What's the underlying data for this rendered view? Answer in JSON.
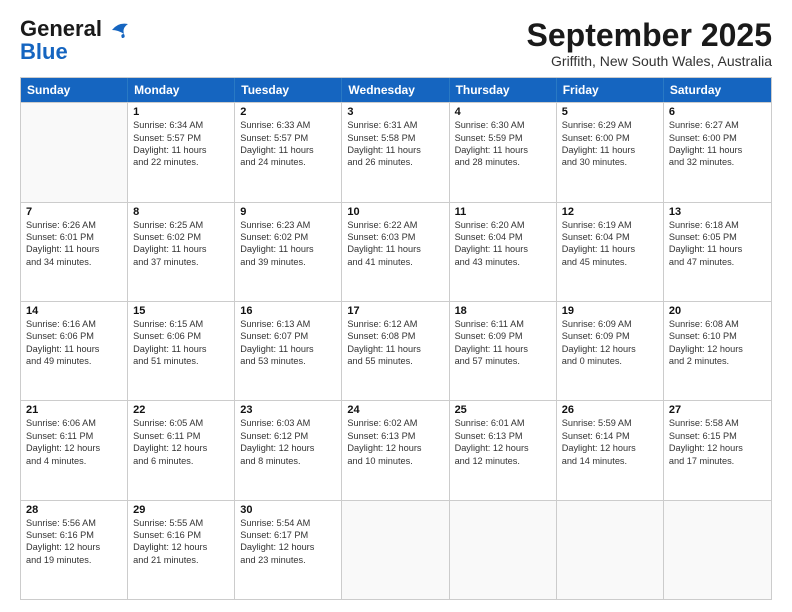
{
  "header": {
    "logo_line1": "General",
    "logo_line2": "Blue",
    "month": "September 2025",
    "location": "Griffith, New South Wales, Australia"
  },
  "weekdays": [
    "Sunday",
    "Monday",
    "Tuesday",
    "Wednesday",
    "Thursday",
    "Friday",
    "Saturday"
  ],
  "weeks": [
    [
      {
        "day": "",
        "lines": []
      },
      {
        "day": "1",
        "lines": [
          "Sunrise: 6:34 AM",
          "Sunset: 5:57 PM",
          "Daylight: 11 hours",
          "and 22 minutes."
        ]
      },
      {
        "day": "2",
        "lines": [
          "Sunrise: 6:33 AM",
          "Sunset: 5:57 PM",
          "Daylight: 11 hours",
          "and 24 minutes."
        ]
      },
      {
        "day": "3",
        "lines": [
          "Sunrise: 6:31 AM",
          "Sunset: 5:58 PM",
          "Daylight: 11 hours",
          "and 26 minutes."
        ]
      },
      {
        "day": "4",
        "lines": [
          "Sunrise: 6:30 AM",
          "Sunset: 5:59 PM",
          "Daylight: 11 hours",
          "and 28 minutes."
        ]
      },
      {
        "day": "5",
        "lines": [
          "Sunrise: 6:29 AM",
          "Sunset: 6:00 PM",
          "Daylight: 11 hours",
          "and 30 minutes."
        ]
      },
      {
        "day": "6",
        "lines": [
          "Sunrise: 6:27 AM",
          "Sunset: 6:00 PM",
          "Daylight: 11 hours",
          "and 32 minutes."
        ]
      }
    ],
    [
      {
        "day": "7",
        "lines": [
          "Sunrise: 6:26 AM",
          "Sunset: 6:01 PM",
          "Daylight: 11 hours",
          "and 34 minutes."
        ]
      },
      {
        "day": "8",
        "lines": [
          "Sunrise: 6:25 AM",
          "Sunset: 6:02 PM",
          "Daylight: 11 hours",
          "and 37 minutes."
        ]
      },
      {
        "day": "9",
        "lines": [
          "Sunrise: 6:23 AM",
          "Sunset: 6:02 PM",
          "Daylight: 11 hours",
          "and 39 minutes."
        ]
      },
      {
        "day": "10",
        "lines": [
          "Sunrise: 6:22 AM",
          "Sunset: 6:03 PM",
          "Daylight: 11 hours",
          "and 41 minutes."
        ]
      },
      {
        "day": "11",
        "lines": [
          "Sunrise: 6:20 AM",
          "Sunset: 6:04 PM",
          "Daylight: 11 hours",
          "and 43 minutes."
        ]
      },
      {
        "day": "12",
        "lines": [
          "Sunrise: 6:19 AM",
          "Sunset: 6:04 PM",
          "Daylight: 11 hours",
          "and 45 minutes."
        ]
      },
      {
        "day": "13",
        "lines": [
          "Sunrise: 6:18 AM",
          "Sunset: 6:05 PM",
          "Daylight: 11 hours",
          "and 47 minutes."
        ]
      }
    ],
    [
      {
        "day": "14",
        "lines": [
          "Sunrise: 6:16 AM",
          "Sunset: 6:06 PM",
          "Daylight: 11 hours",
          "and 49 minutes."
        ]
      },
      {
        "day": "15",
        "lines": [
          "Sunrise: 6:15 AM",
          "Sunset: 6:06 PM",
          "Daylight: 11 hours",
          "and 51 minutes."
        ]
      },
      {
        "day": "16",
        "lines": [
          "Sunrise: 6:13 AM",
          "Sunset: 6:07 PM",
          "Daylight: 11 hours",
          "and 53 minutes."
        ]
      },
      {
        "day": "17",
        "lines": [
          "Sunrise: 6:12 AM",
          "Sunset: 6:08 PM",
          "Daylight: 11 hours",
          "and 55 minutes."
        ]
      },
      {
        "day": "18",
        "lines": [
          "Sunrise: 6:11 AM",
          "Sunset: 6:09 PM",
          "Daylight: 11 hours",
          "and 57 minutes."
        ]
      },
      {
        "day": "19",
        "lines": [
          "Sunrise: 6:09 AM",
          "Sunset: 6:09 PM",
          "Daylight: 12 hours",
          "and 0 minutes."
        ]
      },
      {
        "day": "20",
        "lines": [
          "Sunrise: 6:08 AM",
          "Sunset: 6:10 PM",
          "Daylight: 12 hours",
          "and 2 minutes."
        ]
      }
    ],
    [
      {
        "day": "21",
        "lines": [
          "Sunrise: 6:06 AM",
          "Sunset: 6:11 PM",
          "Daylight: 12 hours",
          "and 4 minutes."
        ]
      },
      {
        "day": "22",
        "lines": [
          "Sunrise: 6:05 AM",
          "Sunset: 6:11 PM",
          "Daylight: 12 hours",
          "and 6 minutes."
        ]
      },
      {
        "day": "23",
        "lines": [
          "Sunrise: 6:03 AM",
          "Sunset: 6:12 PM",
          "Daylight: 12 hours",
          "and 8 minutes."
        ]
      },
      {
        "day": "24",
        "lines": [
          "Sunrise: 6:02 AM",
          "Sunset: 6:13 PM",
          "Daylight: 12 hours",
          "and 10 minutes."
        ]
      },
      {
        "day": "25",
        "lines": [
          "Sunrise: 6:01 AM",
          "Sunset: 6:13 PM",
          "Daylight: 12 hours",
          "and 12 minutes."
        ]
      },
      {
        "day": "26",
        "lines": [
          "Sunrise: 5:59 AM",
          "Sunset: 6:14 PM",
          "Daylight: 12 hours",
          "and 14 minutes."
        ]
      },
      {
        "day": "27",
        "lines": [
          "Sunrise: 5:58 AM",
          "Sunset: 6:15 PM",
          "Daylight: 12 hours",
          "and 17 minutes."
        ]
      }
    ],
    [
      {
        "day": "28",
        "lines": [
          "Sunrise: 5:56 AM",
          "Sunset: 6:16 PM",
          "Daylight: 12 hours",
          "and 19 minutes."
        ]
      },
      {
        "day": "29",
        "lines": [
          "Sunrise: 5:55 AM",
          "Sunset: 6:16 PM",
          "Daylight: 12 hours",
          "and 21 minutes."
        ]
      },
      {
        "day": "30",
        "lines": [
          "Sunrise: 5:54 AM",
          "Sunset: 6:17 PM",
          "Daylight: 12 hours",
          "and 23 minutes."
        ]
      },
      {
        "day": "",
        "lines": []
      },
      {
        "day": "",
        "lines": []
      },
      {
        "day": "",
        "lines": []
      },
      {
        "day": "",
        "lines": []
      }
    ]
  ]
}
